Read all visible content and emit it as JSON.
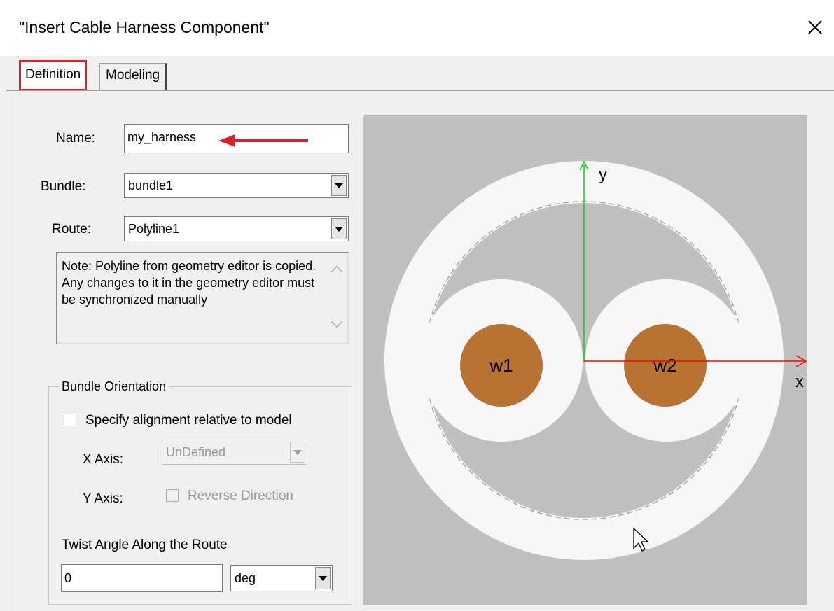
{
  "window": {
    "title": "\"Insert Cable Harness Component\""
  },
  "tabs": {
    "definition": "Definition",
    "modeling": "Modeling"
  },
  "form": {
    "name_label": "Name:",
    "name_value": "my_harness",
    "bundle_label": "Bundle:",
    "bundle_value": "bundle1",
    "route_label": "Route:",
    "route_value": "Polyline1",
    "note": "Note: Polyline from geometry editor is copied. Any changes to it in the geometry editor must be synchronized manually"
  },
  "orientation": {
    "group_title": "Bundle Orientation",
    "specify_label": "Specify alignment relative to model",
    "x_axis_label": "X Axis:",
    "x_axis_value": "UnDefined",
    "y_axis_label": "Y Axis:",
    "reverse_label": "Reverse Direction",
    "twist_label": "Twist Angle Along the Route",
    "twist_value": "0",
    "twist_unit": "deg"
  },
  "preview": {
    "wire1": "w1",
    "wire2": "w2",
    "x_axis": "x",
    "y_axis": "y",
    "colors": {
      "background": "#c0c0c0",
      "insulation": "#f7f7f7",
      "conductor": "#b87333",
      "x_axis": "#ff0000",
      "y_axis": "#00dd00",
      "annotation": "#d6242a"
    }
  }
}
